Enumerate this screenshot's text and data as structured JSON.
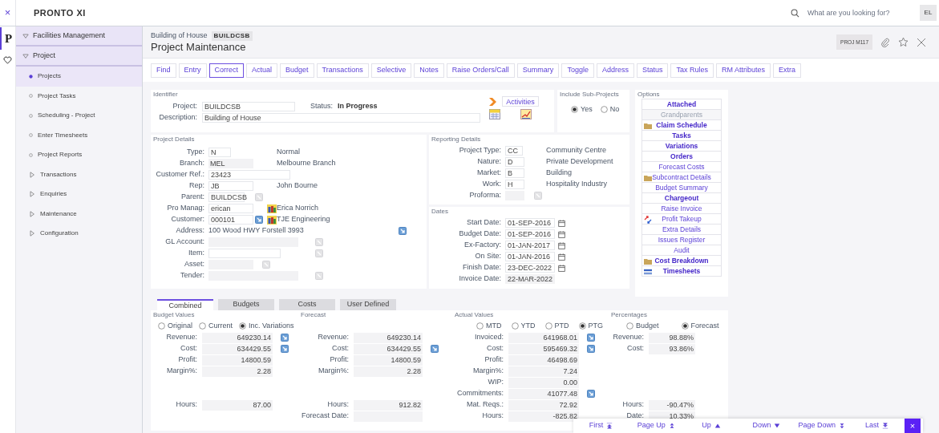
{
  "topbar": {
    "close": "×",
    "logo": "PRONTO XI",
    "search_placeholder": "What are you looking for?",
    "user": "EL"
  },
  "rail": {
    "logo": "P"
  },
  "sidebar": {
    "items": [
      {
        "label": "Facilities Management",
        "expanded": true
      },
      {
        "label": "Project",
        "expanded": true,
        "children": [
          {
            "label": "Projects",
            "kind": "page",
            "selected": true
          },
          {
            "label": "Project Tasks",
            "kind": "page",
            "selected": false
          },
          {
            "label": "Scheduling - Project",
            "kind": "page",
            "selected": false
          },
          {
            "label": "Enter Timesheets",
            "kind": "page",
            "selected": false
          },
          {
            "label": "Project Reports",
            "kind": "page",
            "selected": false
          },
          {
            "label": "Transactions",
            "kind": "folder",
            "expanded": false
          },
          {
            "label": "Enquiries",
            "kind": "folder",
            "expanded": false
          },
          {
            "label": "Maintenance",
            "kind": "folder",
            "expanded": false
          },
          {
            "label": "Configuration",
            "kind": "folder",
            "expanded": false
          }
        ]
      }
    ]
  },
  "header": {
    "subtitle": "Building of House",
    "code": "BUILDCSB",
    "title": "Project Maintenance",
    "program": "PROJ M117"
  },
  "toolbar": [
    {
      "label": "Find",
      "selected": false
    },
    {
      "label": "Entry",
      "selected": false
    },
    {
      "label": "Correct",
      "selected": true
    },
    {
      "label": "Actual",
      "selected": false
    },
    {
      "label": "Budget",
      "selected": false
    },
    {
      "label": "Transactions",
      "selected": false
    },
    {
      "label": "Selective",
      "selected": false
    },
    {
      "label": "Notes",
      "selected": false
    },
    {
      "label": "Raise Orders/Call",
      "selected": false
    },
    {
      "label": "Summary",
      "selected": false
    },
    {
      "label": "Toggle",
      "selected": false
    },
    {
      "label": "Address",
      "selected": false
    },
    {
      "label": "Status",
      "selected": false
    },
    {
      "label": "Tax Rules",
      "selected": false
    },
    {
      "label": "RM Attributes",
      "selected": false
    },
    {
      "label": "Extra",
      "selected": false
    }
  ],
  "identifier": {
    "title": "Identifier",
    "project_label": "Project:",
    "project": "BUILDCSB",
    "status_label": "Status:",
    "status": "In Progress",
    "description_label": "Description:",
    "description": "Building of House",
    "activities": "Activities"
  },
  "sub_projects": {
    "title": "Include Sub-Projects",
    "options": [
      {
        "label": "Yes",
        "selected": true
      },
      {
        "label": "No",
        "selected": false
      }
    ]
  },
  "project_details": {
    "title": "Project Details",
    "fields": [
      {
        "label": "Type:",
        "value": "N",
        "kind": "input",
        "description": "Normal"
      },
      {
        "label": "Branch:",
        "value": "MEL",
        "kind": "readonly",
        "description": "Melbourne Branch"
      },
      {
        "label": "Customer Ref.:",
        "value": "23423",
        "kind": "input"
      },
      {
        "label": "Rep:",
        "value": "JB",
        "kind": "input",
        "description": "John Bourne"
      },
      {
        "label": "Parent:",
        "value": "BUILDCSB",
        "kind": "input",
        "lookup": {
          "disabled": true
        }
      },
      {
        "label": "Pro Manag:",
        "value": "erican",
        "kind": "input",
        "contact": true,
        "description": "Erica Norrich"
      },
      {
        "label": "Customer:",
        "value": "000101",
        "kind": "input",
        "lookup": {
          "disabled": false
        },
        "contact": true,
        "description": "TJE Engineering"
      },
      {
        "label": "Address:",
        "value": "100 Wood HWY Forstell 3993",
        "kind": "text",
        "lookup": {
          "disabled": false
        }
      },
      {
        "label": "GL Account:",
        "kind": "readonly",
        "lookup": {
          "disabled": true
        }
      },
      {
        "label": "Item:",
        "kind": "input",
        "lookup": {
          "disabled": true
        }
      },
      {
        "label": "Asset:",
        "kind": "readonly",
        "lookup": {
          "disabled": true
        }
      },
      {
        "label": "Tender:",
        "kind": "readonly",
        "lookup": {
          "disabled": true
        }
      }
    ]
  },
  "reporting": {
    "title": "Reporting Details",
    "fields": [
      {
        "label": "Project Type:",
        "value": "CC",
        "kind": "input",
        "description": "Community Centre"
      },
      {
        "label": "Nature:",
        "value": "D",
        "kind": "input",
        "description": "Private Development"
      },
      {
        "label": "Market:",
        "value": "B",
        "kind": "input",
        "description": "Building"
      },
      {
        "label": "Work:",
        "value": "H",
        "kind": "input",
        "description": "Hospitality Industry"
      },
      {
        "label": "Proforma:",
        "kind": "readonly",
        "lookup": {
          "disabled": true
        }
      }
    ]
  },
  "dates": {
    "title": "Dates",
    "fields": [
      {
        "label": "Start Date:",
        "value": "01-SEP-2016",
        "kind": "input",
        "calendar": true
      },
      {
        "label": "Budget Date:",
        "value": "01-SEP-2016",
        "kind": "input",
        "calendar": true
      },
      {
        "label": "Ex-Factory:",
        "value": "01-JAN-2017",
        "kind": "input",
        "calendar": true
      },
      {
        "label": "On Site:",
        "value": "01-JAN-2016",
        "kind": "input",
        "calendar": true
      },
      {
        "label": "Finish Date:",
        "value": "23-DEC-2022",
        "kind": "input",
        "calendar": true
      },
      {
        "label": "Invoice Date:",
        "value": "22-MAR-2022",
        "kind": "readonly",
        "calendar": false
      }
    ]
  },
  "options": {
    "title": "Options",
    "items": [
      {
        "label": "Attached",
        "kind": "plain",
        "emphasized": true,
        "disabled": false
      },
      {
        "label": "Grandparents",
        "kind": "plain",
        "emphasized": false,
        "disabled": true
      },
      {
        "label": "Claim Schedule",
        "kind": "folder",
        "emphasized": true,
        "disabled": false
      },
      {
        "label": "Tasks",
        "kind": "plain",
        "emphasized": true,
        "disabled": false
      },
      {
        "label": "Variations",
        "kind": "plain",
        "emphasized": true,
        "disabled": false
      },
      {
        "label": "Orders",
        "kind": "plain",
        "emphasized": true,
        "disabled": false
      },
      {
        "label": "Forecast Costs",
        "kind": "plain",
        "emphasized": false,
        "disabled": false
      },
      {
        "label": "Subcontract Details",
        "kind": "folder",
        "emphasized": false,
        "disabled": false
      },
      {
        "label": "Budget Summary",
        "kind": "plain",
        "emphasized": false,
        "disabled": false
      },
      {
        "label": "Chargeout",
        "kind": "plain",
        "emphasized": true,
        "disabled": false
      },
      {
        "label": "Raise Invoice",
        "kind": "plain",
        "emphasized": false,
        "disabled": false
      },
      {
        "label": "Profit Takeup",
        "kind": "arrows",
        "emphasized": false,
        "disabled": false
      },
      {
        "label": "Extra Details",
        "kind": "plain",
        "emphasized": false,
        "disabled": false
      },
      {
        "label": "Issues Register",
        "kind": "plain",
        "emphasized": false,
        "disabled": false
      },
      {
        "label": "Audit",
        "kind": "plain",
        "emphasized": false,
        "disabled": false
      },
      {
        "label": "Cost Breakdown",
        "kind": "folder",
        "emphasized": true,
        "disabled": false
      },
      {
        "label": "Timesheets",
        "kind": "sheet",
        "emphasized": true,
        "disabled": false
      }
    ]
  },
  "lower_tabs": [
    {
      "label": "Combined",
      "selected": true
    },
    {
      "label": "Budgets",
      "selected": false
    },
    {
      "label": "Costs",
      "selected": false
    },
    {
      "label": "User Defined",
      "selected": false
    }
  ],
  "value_panels": [
    {
      "title": "Budget Values",
      "options": [
        {
          "label": "Original",
          "selected": false
        },
        {
          "label": "Current",
          "selected": false
        },
        {
          "label": "Inc. Variations",
          "selected": true
        }
      ],
      "rows": [
        {
          "label": "Revenue:",
          "value": "649230.14",
          "lookup": true
        },
        {
          "label": "Cost:",
          "value": "634429.55",
          "lookup": true
        },
        {
          "label": "Profit:",
          "value": "14800.59",
          "lookup": false
        },
        {
          "label": "Margin%:",
          "value": "2.28",
          "lookup": false
        }
      ],
      "footer_rows": [
        {
          "label": "Hours:",
          "value": "87.00",
          "lookup": false
        }
      ]
    },
    {
      "title": "Forecast",
      "rows": [
        {
          "label": "Revenue:",
          "value": "649230.14",
          "lookup": false
        },
        {
          "label": "Cost:",
          "value": "634429.55",
          "lookup": true
        },
        {
          "label": "Profit:",
          "value": "14800.59",
          "lookup": false
        },
        {
          "label": "Margin%:",
          "value": "2.28",
          "lookup": false
        }
      ],
      "footer_rows": [
        {
          "label": "Hours:",
          "value": "912.82",
          "lookup": false
        },
        {
          "label": "Forecast Date:",
          "lookup": false
        }
      ]
    },
    {
      "title": "Actual Values",
      "options": [
        {
          "label": "MTD",
          "selected": false
        },
        {
          "label": "YTD",
          "selected": false
        },
        {
          "label": "PTD",
          "selected": false
        },
        {
          "label": "PTG",
          "selected": true
        }
      ],
      "rows": [
        {
          "label": "Invoiced:",
          "value": "641968.01",
          "lookup": true
        },
        {
          "label": "Cost:",
          "value": "595469.32",
          "lookup": true
        },
        {
          "label": "Profit:",
          "value": "46498.69",
          "lookup": false
        },
        {
          "label": "Margin%:",
          "value": "7.24",
          "lookup": false
        },
        {
          "label": "WIP:",
          "value": "0.00",
          "lookup": false
        },
        {
          "label": "Commitments:",
          "value": "41077.48",
          "lookup": true
        },
        {
          "label": "Mat. Reqs.:",
          "value": "72.92",
          "lookup": false
        },
        {
          "label": "Hours:",
          "value": "-825.82",
          "lookup": false
        }
      ]
    },
    {
      "title": "Percentages",
      "options": [
        {
          "label": "Budget",
          "selected": false
        },
        {
          "label": "Forecast",
          "selected": true
        }
      ],
      "rows": [
        {
          "label": "Revenue:",
          "value": "98.88%",
          "lookup": false
        },
        {
          "label": "Cost:",
          "value": "93.86%",
          "lookup": false
        }
      ],
      "footer_rows": [
        {
          "label": "Hours:",
          "value": "-90.47%",
          "lookup": false
        },
        {
          "label": "Date:",
          "value": "10.33%",
          "lookup": false
        }
      ]
    }
  ],
  "pager": {
    "items": [
      {
        "label": "First",
        "kind": "first"
      },
      {
        "label": "Page Up",
        "kind": "page_up"
      },
      {
        "label": "Up",
        "kind": "up"
      },
      {
        "label": "Down",
        "kind": "down"
      },
      {
        "label": "Page Down",
        "kind": "page_down"
      },
      {
        "label": "Last",
        "kind": "last"
      }
    ],
    "close": "×"
  }
}
